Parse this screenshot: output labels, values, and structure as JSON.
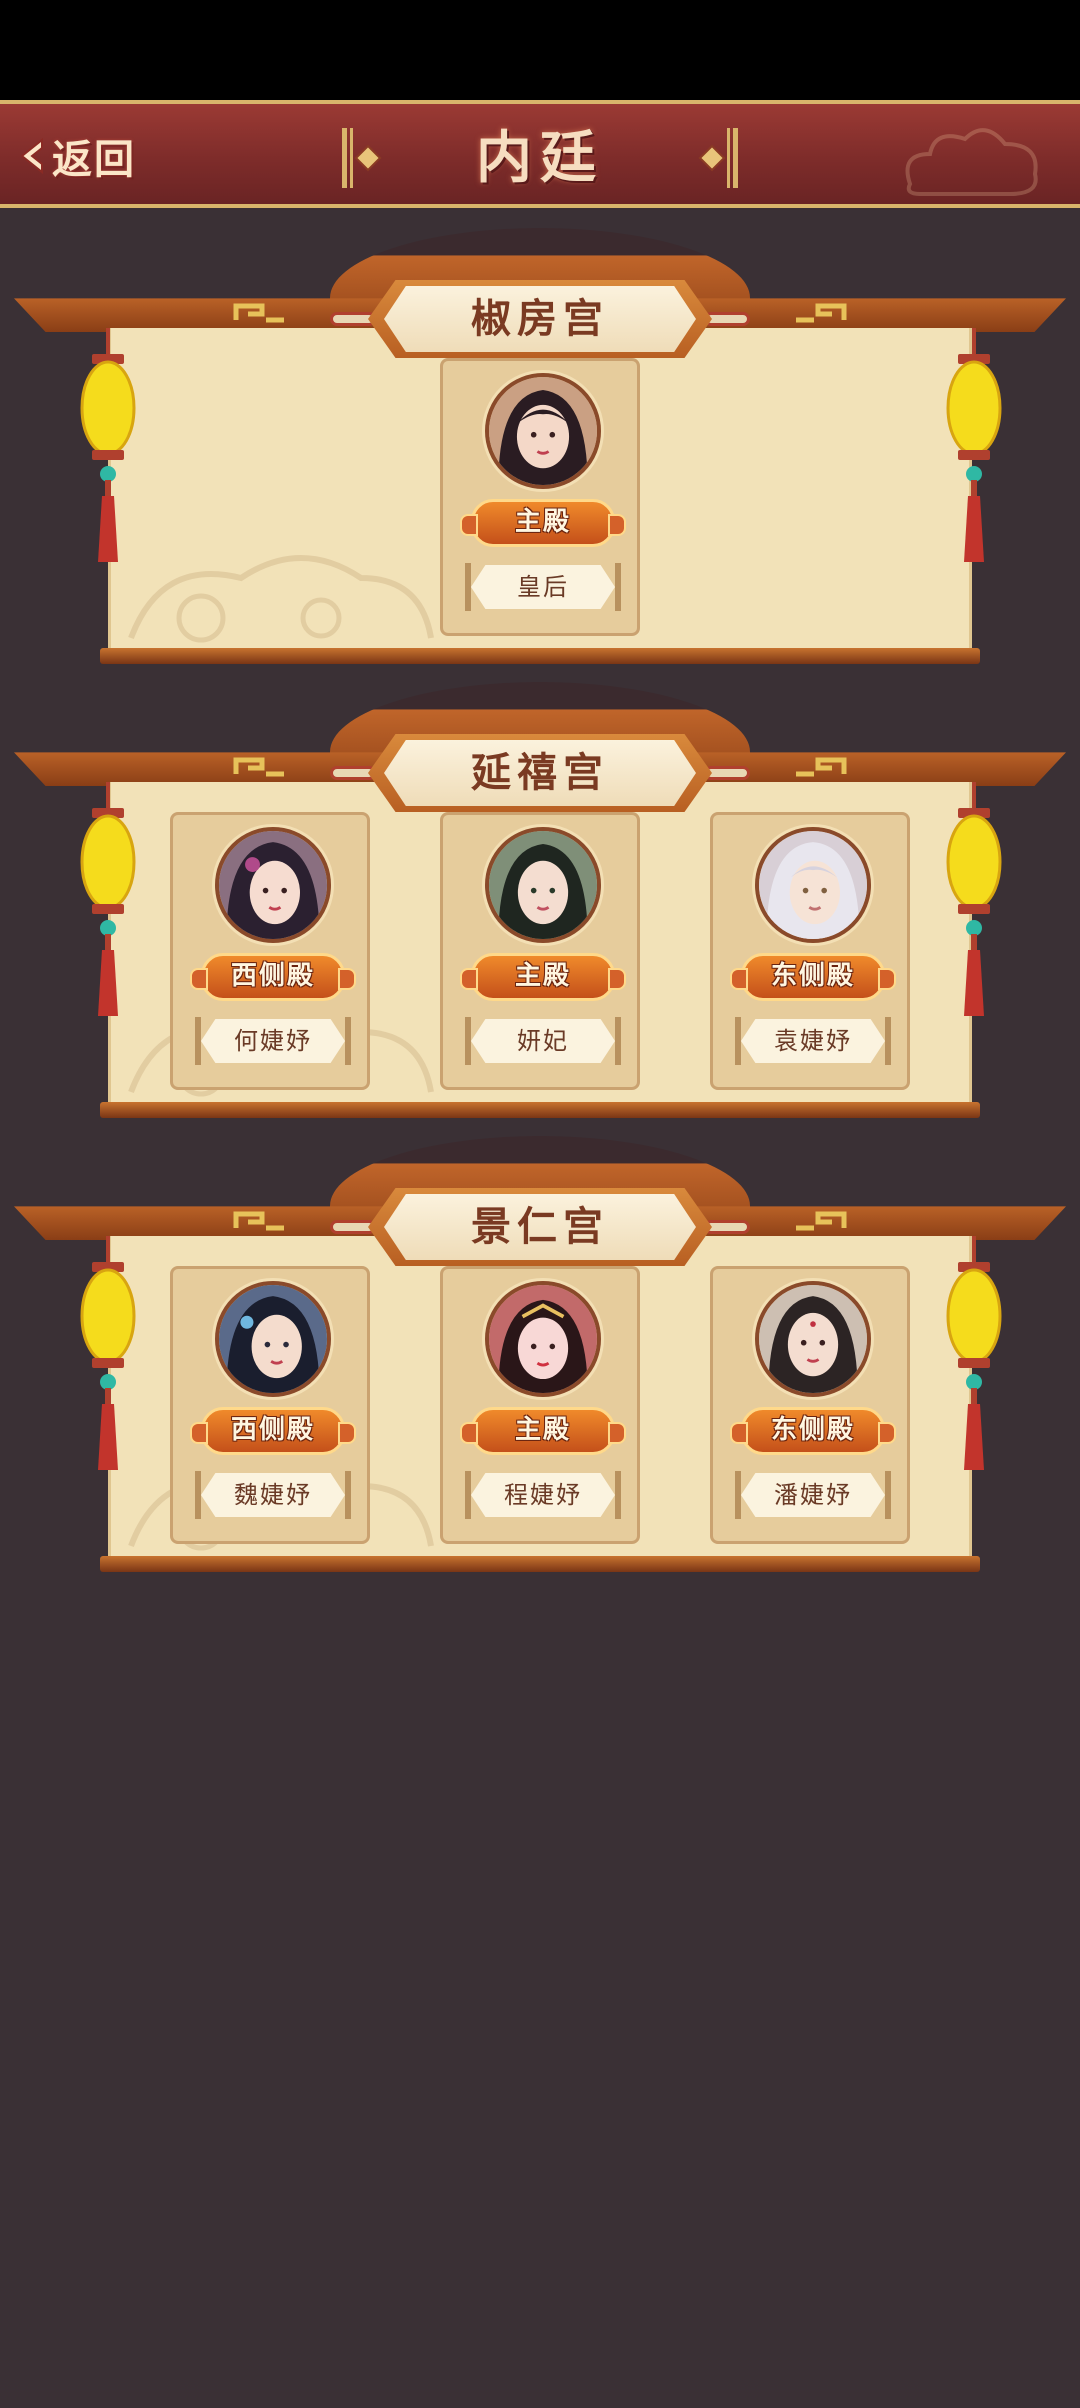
{
  "header": {
    "back_label": "返回",
    "title": "内廷"
  },
  "colors": {
    "header_bg": "#8a3030",
    "page_bg": "#3a3035",
    "panel_bg": "#f2e2b8",
    "badge": "#e0702a"
  },
  "palaces": [
    {
      "name": "椒房宫",
      "slots": [
        {
          "hall": "主殿",
          "rank": "皇后",
          "avatar": "empress-portrait"
        }
      ]
    },
    {
      "name": "延禧宫",
      "slots": [
        {
          "hall": "西侧殿",
          "rank": "何婕妤",
          "avatar": "consort-portrait"
        },
        {
          "hall": "主殿",
          "rank": "妍妃",
          "avatar": "consort-portrait"
        },
        {
          "hall": "东侧殿",
          "rank": "袁婕妤",
          "avatar": "consort-portrait"
        }
      ]
    },
    {
      "name": "景仁宫",
      "slots": [
        {
          "hall": "西侧殿",
          "rank": "魏婕妤",
          "avatar": "consort-portrait"
        },
        {
          "hall": "主殿",
          "rank": "程婕妤",
          "avatar": "consort-portrait"
        },
        {
          "hall": "东侧殿",
          "rank": "潘婕妤",
          "avatar": "consort-portrait"
        }
      ]
    }
  ]
}
